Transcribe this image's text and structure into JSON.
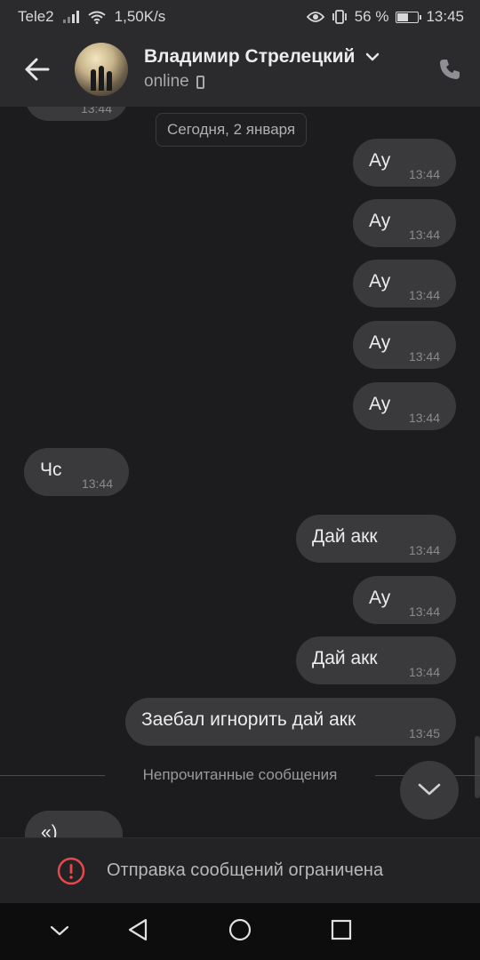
{
  "status_bar": {
    "carrier": "Tele2",
    "net_speed": "1,50K/s",
    "battery_percent": "56 %",
    "battery_level": 0.56,
    "time": "13:45"
  },
  "header": {
    "contact_name": "Владимир Стрелецкий",
    "status": "online"
  },
  "chat": {
    "date_separator": "Сегодня, 2 января",
    "messages": [
      {
        "text": "Ау",
        "time": "13:44",
        "side": "out"
      },
      {
        "text": "Ау",
        "time": "13:44",
        "side": "out"
      },
      {
        "text": "Ау",
        "time": "13:44",
        "side": "out"
      },
      {
        "text": "Ау",
        "time": "13:44",
        "side": "out"
      },
      {
        "text": "Ау",
        "time": "13:44",
        "side": "out"
      },
      {
        "text": "Чс",
        "time": "13:44",
        "side": "in"
      },
      {
        "text": "Дай акк",
        "time": "13:44",
        "side": "out"
      },
      {
        "text": "Ау",
        "time": "13:44",
        "side": "out"
      },
      {
        "text": "Дай акк",
        "time": "13:44",
        "side": "out"
      },
      {
        "text": "Заебал игнорить дай акк",
        "time": "13:45",
        "side": "out"
      }
    ],
    "top_partial_time": "13:44",
    "unread_label": "Непрочитанные сообщения",
    "bottom_partial_text": "«)"
  },
  "restriction": {
    "message": "Отправка сообщений ограничена",
    "icon_color": "#e5484d"
  },
  "icons": {
    "back": "arrow-left-icon",
    "call": "phone-icon",
    "scroll_down": "chevron-down-icon",
    "warning": "exclamation-circle-icon"
  }
}
